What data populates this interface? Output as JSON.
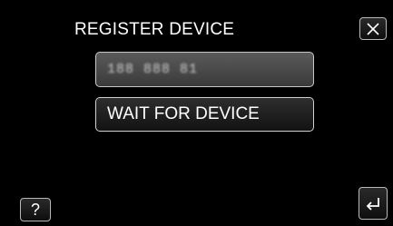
{
  "screen": {
    "title": "REGISTER DEVICE"
  },
  "code_field": {
    "value": "188 888 81"
  },
  "actions": {
    "wait_label": "WAIT FOR DEVICE"
  },
  "buttons": {
    "help_label": "?"
  },
  "icons": {
    "close": "close-icon",
    "back": "back-arrow-icon"
  },
  "colors": {
    "background": "#000000",
    "text": "#ffffff",
    "button_border": "#c8c8c8"
  }
}
